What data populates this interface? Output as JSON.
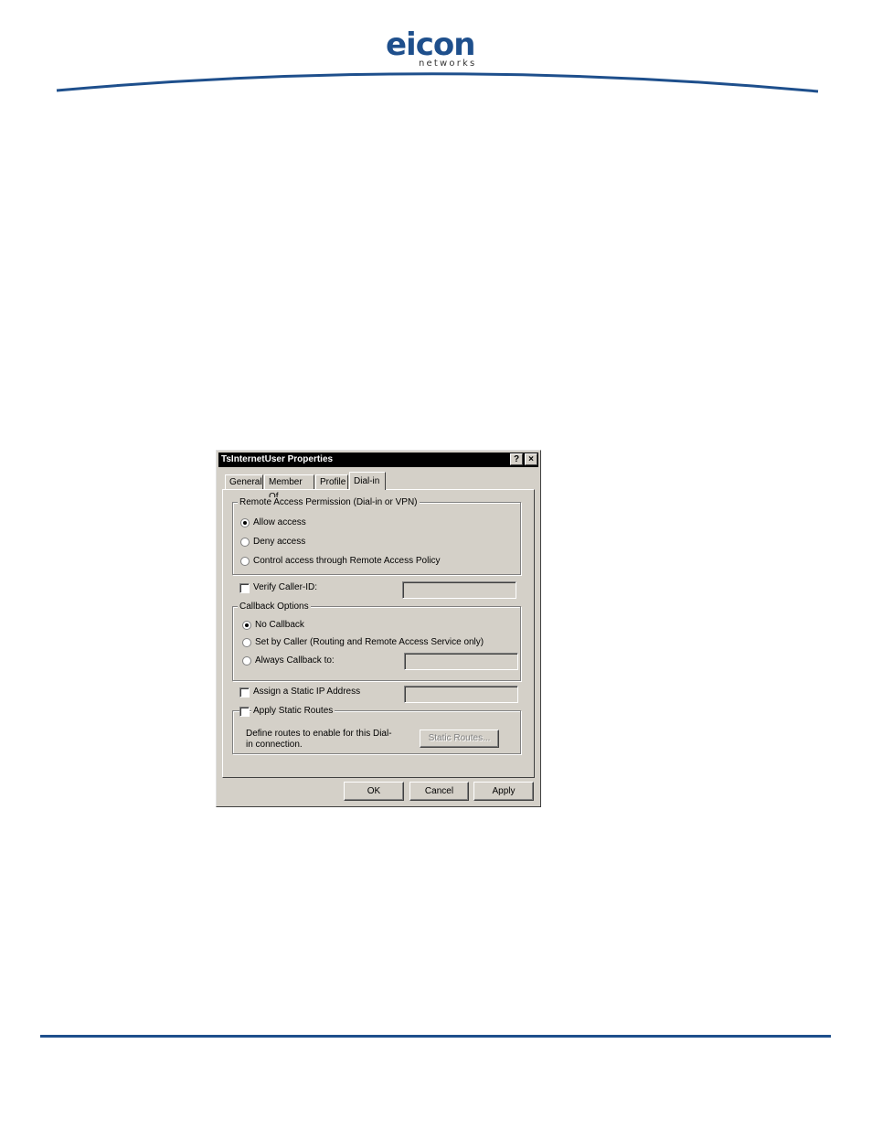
{
  "brand": {
    "name": "eicon",
    "tagline": "networks",
    "color": "#1e4f8c"
  },
  "dialog": {
    "title": "TsInternetUser Properties",
    "help_glyph": "?",
    "close_glyph": "×",
    "tabs": [
      {
        "label": "General",
        "active": false
      },
      {
        "label": "Member Of",
        "active": false
      },
      {
        "label": "Profile",
        "active": false
      },
      {
        "label": "Dial-in",
        "active": true
      }
    ],
    "remote_access": {
      "legend": "Remote Access Permission (Dial-in or VPN)",
      "options": [
        {
          "label": "Allow access",
          "selected": true
        },
        {
          "label": "Deny access",
          "selected": false
        },
        {
          "label": "Control access through Remote Access Policy",
          "selected": false
        }
      ]
    },
    "verify_caller_id": {
      "label": "Verify Caller-ID:",
      "checked": false,
      "value": ""
    },
    "callback": {
      "legend": "Callback Options",
      "options": [
        {
          "label": "No Callback",
          "selected": true
        },
        {
          "label": "Set by Caller (Routing and Remote Access Service only)",
          "selected": false
        },
        {
          "label": "Always Callback to:",
          "selected": false
        }
      ],
      "number": ""
    },
    "static_ip": {
      "label": "Assign a Static IP Address",
      "checked": false,
      "value": ""
    },
    "static_routes": {
      "label": "Apply Static Routes",
      "checked": false,
      "description": "Define routes to enable for this Dial-in connection.",
      "button": "Static Routes..."
    },
    "buttons": {
      "ok": "OK",
      "cancel": "Cancel",
      "apply": "Apply"
    }
  }
}
